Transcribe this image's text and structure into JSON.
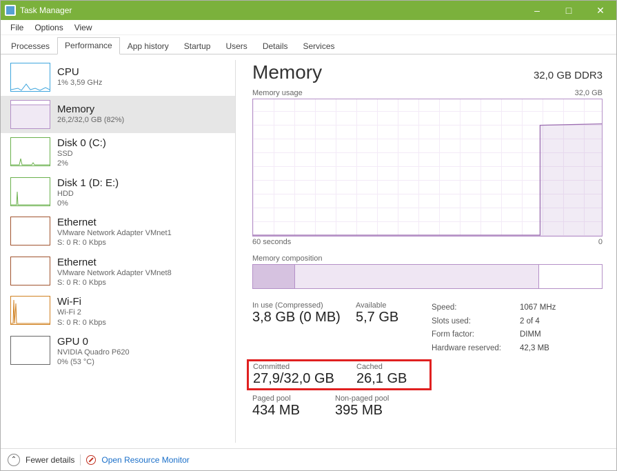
{
  "window": {
    "title": "Task Manager"
  },
  "menu": [
    "File",
    "Options",
    "View"
  ],
  "tabs": [
    "Processes",
    "Performance",
    "App history",
    "Startup",
    "Users",
    "Details",
    "Services"
  ],
  "active_tab_index": 1,
  "sidebar": {
    "items": [
      {
        "title": "CPU",
        "sub1": "1% 3,59 GHz",
        "sub2": ""
      },
      {
        "title": "Memory",
        "sub1": "26,2/32,0 GB (82%)",
        "sub2": ""
      },
      {
        "title": "Disk 0 (C:)",
        "sub1": "SSD",
        "sub2": "2%"
      },
      {
        "title": "Disk 1 (D: E:)",
        "sub1": "HDD",
        "sub2": "0%"
      },
      {
        "title": "Ethernet",
        "sub1": "VMware Network Adapter VMnet1",
        "sub2": "S: 0 R: 0 Kbps"
      },
      {
        "title": "Ethernet",
        "sub1": "VMware Network Adapter VMnet8",
        "sub2": "S: 0 R: 0 Kbps"
      },
      {
        "title": "Wi-Fi",
        "sub1": "Wi-Fi 2",
        "sub2": "S: 0 R: 0 Kbps"
      },
      {
        "title": "GPU 0",
        "sub1": "NVIDIA Quadro P620",
        "sub2": "0% (53 °C)"
      }
    ],
    "selected_index": 1
  },
  "detail": {
    "title": "Memory",
    "spec": "32,0 GB DDR3",
    "usage_label": "Memory usage",
    "usage_max": "32,0 GB",
    "x_left": "60 seconds",
    "x_right": "0",
    "composition_label": "Memory composition",
    "stats": {
      "inuse_label": "In use (Compressed)",
      "inuse_value": "3,8 GB (0 MB)",
      "available_label": "Available",
      "available_value": "5,7 GB",
      "committed_label": "Committed",
      "committed_value": "27,9/32,0 GB",
      "cached_label": "Cached",
      "cached_value": "26,1 GB",
      "pagedpool_label": "Paged pool",
      "pagedpool_value": "434 MB",
      "nonpaged_label": "Non-paged pool",
      "nonpaged_value": "395 MB"
    },
    "kv": [
      {
        "k": "Speed:",
        "v": "1067 MHz"
      },
      {
        "k": "Slots used:",
        "v": "2 of 4"
      },
      {
        "k": "Form factor:",
        "v": "DIMM"
      },
      {
        "k": "Hardware reserved:",
        "v": "42,3 MB"
      }
    ]
  },
  "footer": {
    "fewer": "Fewer details",
    "resmon": "Open Resource Monitor"
  },
  "chart_data": {
    "type": "line",
    "title": "Memory usage",
    "xlabel": "seconds",
    "ylabel": "GB",
    "x_range_seconds": [
      60,
      0
    ],
    "ylim": [
      0,
      32
    ],
    "series": [
      {
        "name": "Memory in use",
        "approx_values_gb_over_time": "≈0 GB from 60s to ~8s, then step to ≈26 GB and hold until 0s"
      }
    ],
    "composition_bar": {
      "segments": [
        {
          "name": "In use",
          "approx_gb": 3.8
        },
        {
          "name": "Modified/Standby (cached)",
          "approx_gb": 22.5
        },
        {
          "name": "Free",
          "approx_gb": 5.7
        }
      ],
      "total_gb": 32.0
    }
  }
}
